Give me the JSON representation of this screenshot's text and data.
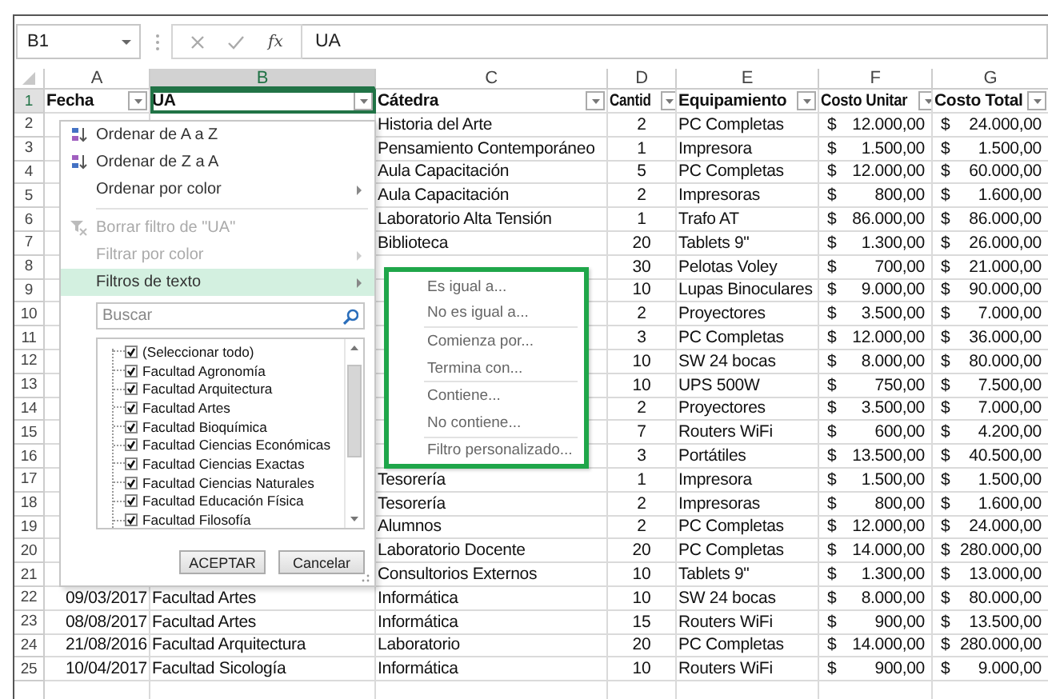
{
  "formula_bar": {
    "name_box": "B1",
    "function_label": "fx",
    "value": "UA"
  },
  "column_headers": [
    {
      "label": "A",
      "selected": false
    },
    {
      "label": "B",
      "selected": true
    },
    {
      "label": "C",
      "selected": false
    },
    {
      "label": "D",
      "selected": false
    },
    {
      "label": "E",
      "selected": false
    },
    {
      "label": "F",
      "selected": false
    },
    {
      "label": "G",
      "selected": false
    }
  ],
  "header_row": {
    "number": "1",
    "selected": true,
    "cells": [
      {
        "text": "Fecha",
        "filter": true,
        "active": false
      },
      {
        "text": "UA",
        "filter": true,
        "active": true
      },
      {
        "text": "Cátedra",
        "filter": true,
        "active": false
      },
      {
        "text": "Cantid",
        "filter": true,
        "active": false
      },
      {
        "text": "Equipamiento",
        "filter": true,
        "active": false
      },
      {
        "text": "Costo Unitar",
        "filter": true,
        "active": false
      },
      {
        "text": "Costo Total",
        "filter": true,
        "active": false
      }
    ]
  },
  "rows": [
    {
      "number": "2",
      "selected": false,
      "catedra": "Historia del Arte",
      "cantidad": "2",
      "equipamiento": "PC Completas",
      "costo_unitario": {
        "symbol": "$",
        "amount": "12.000,00"
      },
      "costo_total": {
        "symbol": "$",
        "amount": "24.000,00"
      }
    },
    {
      "number": "3",
      "selected": false,
      "catedra": "Pensamiento Contemporáneo",
      "cantidad": "1",
      "equipamiento": "Impresora",
      "costo_unitario": {
        "symbol": "$",
        "amount": "1.500,00"
      },
      "costo_total": {
        "symbol": "$",
        "amount": "1.500,00"
      }
    },
    {
      "number": "4",
      "selected": false,
      "catedra": "Aula Capacitación",
      "cantidad": "5",
      "equipamiento": "PC Completas",
      "costo_unitario": {
        "symbol": "$",
        "amount": "12.000,00"
      },
      "costo_total": {
        "symbol": "$",
        "amount": "60.000,00"
      }
    },
    {
      "number": "5",
      "selected": false,
      "catedra": "Aula Capacitación",
      "cantidad": "2",
      "equipamiento": "Impresoras",
      "costo_unitario": {
        "symbol": "$",
        "amount": "800,00"
      },
      "costo_total": {
        "symbol": "$",
        "amount": "1.600,00"
      }
    },
    {
      "number": "6",
      "selected": false,
      "catedra": "Laboratorio Alta Tensión",
      "cantidad": "1",
      "equipamiento": "Trafo AT",
      "costo_unitario": {
        "symbol": "$",
        "amount": "86.000,00"
      },
      "costo_total": {
        "symbol": "$",
        "amount": "86.000,00"
      }
    },
    {
      "number": "7",
      "selected": false,
      "catedra": "Biblioteca",
      "cantidad": "20",
      "equipamiento": "Tablets 9\"",
      "costo_unitario": {
        "symbol": "$",
        "amount": "1.300,00"
      },
      "costo_total": {
        "symbol": "$",
        "amount": "26.000,00"
      }
    },
    {
      "number": "8",
      "selected": false,
      "cantidad": "30",
      "equipamiento": "Pelotas Voley",
      "costo_unitario": {
        "symbol": "$",
        "amount": "700,00"
      },
      "costo_total": {
        "symbol": "$",
        "amount": "21.000,00"
      }
    },
    {
      "number": "9",
      "selected": false,
      "cantidad": "10",
      "equipamiento": "Lupas Binoculares",
      "costo_unitario": {
        "symbol": "$",
        "amount": "9.000,00"
      },
      "costo_total": {
        "symbol": "$",
        "amount": "90.000,00"
      }
    },
    {
      "number": "10",
      "selected": false,
      "cantidad": "2",
      "equipamiento": "Proyectores",
      "costo_unitario": {
        "symbol": "$",
        "amount": "3.500,00"
      },
      "costo_total": {
        "symbol": "$",
        "amount": "7.000,00"
      }
    },
    {
      "number": "11",
      "selected": false,
      "cantidad": "3",
      "equipamiento": "PC Completas",
      "costo_unitario": {
        "symbol": "$",
        "amount": "12.000,00"
      },
      "costo_total": {
        "symbol": "$",
        "amount": "36.000,00"
      }
    },
    {
      "number": "12",
      "selected": false,
      "cantidad": "10",
      "equipamiento": "SW 24 bocas",
      "costo_unitario": {
        "symbol": "$",
        "amount": "8.000,00"
      },
      "costo_total": {
        "symbol": "$",
        "amount": "80.000,00"
      }
    },
    {
      "number": "13",
      "selected": false,
      "cantidad": "10",
      "equipamiento": "UPS 500W",
      "costo_unitario": {
        "symbol": "$",
        "amount": "750,00"
      },
      "costo_total": {
        "symbol": "$",
        "amount": "7.500,00"
      }
    },
    {
      "number": "14",
      "selected": false,
      "cantidad": "2",
      "equipamiento": "Proyectores",
      "costo_unitario": {
        "symbol": "$",
        "amount": "3.500,00"
      },
      "costo_total": {
        "symbol": "$",
        "amount": "7.000,00"
      }
    },
    {
      "number": "15",
      "selected": false,
      "cantidad": "7",
      "equipamiento": "Routers WiFi",
      "costo_unitario": {
        "symbol": "$",
        "amount": "600,00"
      },
      "costo_total": {
        "symbol": "$",
        "amount": "4.200,00"
      }
    },
    {
      "number": "16",
      "selected": false,
      "cantidad": "3",
      "equipamiento": "Portátiles",
      "costo_unitario": {
        "symbol": "$",
        "amount": "13.500,00"
      },
      "costo_total": {
        "symbol": "$",
        "amount": "40.500,00"
      }
    },
    {
      "number": "17",
      "selected": false,
      "catedra": "Tesorería",
      "cantidad": "1",
      "equipamiento": "Impresora",
      "costo_unitario": {
        "symbol": "$",
        "amount": "1.500,00"
      },
      "costo_total": {
        "symbol": "$",
        "amount": "1.500,00"
      }
    },
    {
      "number": "18",
      "selected": false,
      "catedra": "Tesorería",
      "cantidad": "2",
      "equipamiento": "Impresoras",
      "costo_unitario": {
        "symbol": "$",
        "amount": "800,00"
      },
      "costo_total": {
        "symbol": "$",
        "amount": "1.600,00"
      }
    },
    {
      "number": "19",
      "selected": false,
      "catedra": "Alumnos",
      "cantidad": "2",
      "equipamiento": "PC Completas",
      "costo_unitario": {
        "symbol": "$",
        "amount": "12.000,00"
      },
      "costo_total": {
        "symbol": "$",
        "amount": "24.000,00"
      }
    },
    {
      "number": "20",
      "selected": false,
      "catedra": "Laboratorio Docente",
      "cantidad": "20",
      "equipamiento": "PC Completas",
      "costo_unitario": {
        "symbol": "$",
        "amount": "14.000,00"
      },
      "costo_total": {
        "symbol": "$",
        "amount": "280.000,00"
      }
    },
    {
      "number": "21",
      "selected": false,
      "catedra": "Consultorios Externos",
      "cantidad": "10",
      "equipamiento": "Tablets 9\"",
      "costo_unitario": {
        "symbol": "$",
        "amount": "1.300,00"
      },
      "costo_total": {
        "symbol": "$",
        "amount": "13.000,00"
      }
    },
    {
      "number": "22",
      "selected": false,
      "fecha": "09/03/2017",
      "ua": "Facultad Artes",
      "catedra": "Informática",
      "cantidad": "10",
      "equipamiento": "SW 24 bocas",
      "costo_unitario": {
        "symbol": "$",
        "amount": "8.000,00"
      },
      "costo_total": {
        "symbol": "$",
        "amount": "80.000,00"
      }
    },
    {
      "number": "23",
      "selected": false,
      "fecha": "08/08/2017",
      "ua": "Facultad Artes",
      "catedra": "Informática",
      "cantidad": "15",
      "equipamiento": "Routers WiFi",
      "costo_unitario": {
        "symbol": "$",
        "amount": "900,00"
      },
      "costo_total": {
        "symbol": "$",
        "amount": "13.500,00"
      }
    },
    {
      "number": "24",
      "selected": false,
      "fecha": "21/08/2016",
      "ua": "Facultad Arquitectura",
      "catedra": "Laboratorio",
      "cantidad": "20",
      "equipamiento": "PC Completas",
      "costo_unitario": {
        "symbol": "$",
        "amount": "14.000,00"
      },
      "costo_total": {
        "symbol": "$",
        "amount": "280.000,00"
      }
    },
    {
      "number": "25",
      "selected": false,
      "fecha": "10/04/2017",
      "ua": "Facultad Sicología",
      "catedra": "Informática",
      "cantidad": "10",
      "equipamiento": "Routers WiFi",
      "costo_unitario": {
        "symbol": "$",
        "amount": "900,00"
      },
      "costo_total": {
        "symbol": "$",
        "amount": "9.000,00"
      }
    }
  ],
  "filter_menu": {
    "items": [
      {
        "kind": "sort_ascending",
        "label": "Ordenar de A a Z",
        "disabled": false,
        "selected": false,
        "submenu": false
      },
      {
        "kind": "sort_descending",
        "label": "Ordenar de Z a A",
        "disabled": false,
        "selected": false,
        "submenu": false
      },
      {
        "kind": "item",
        "label": "Ordenar por color",
        "disabled": false,
        "selected": false,
        "submenu": true
      },
      {
        "kind": "separator"
      },
      {
        "kind": "clear_filter",
        "label": "Borrar filtro de \"UA\"",
        "disabled": true,
        "selected": false,
        "submenu": false
      },
      {
        "kind": "item",
        "label": "Filtrar por color",
        "disabled": true,
        "selected": false,
        "submenu": true
      },
      {
        "kind": "item",
        "label": "Filtros de texto",
        "disabled": false,
        "selected": true,
        "submenu": true
      }
    ],
    "search": {
      "placeholder": "Buscar"
    },
    "values": [
      {
        "label": "(Seleccionar todo)",
        "checked": true
      },
      {
        "label": "Facultad Agronomía",
        "checked": true
      },
      {
        "label": "Facultad Arquitectura",
        "checked": true
      },
      {
        "label": "Facultad Artes",
        "checked": true
      },
      {
        "label": "Facultad Bioquímica",
        "checked": true
      },
      {
        "label": "Facultad Ciencias Económicas",
        "checked": true
      },
      {
        "label": "Facultad Ciencias Exactas",
        "checked": true
      },
      {
        "label": "Facultad Ciencias Naturales",
        "checked": true
      },
      {
        "label": "Facultad Educación Física",
        "checked": true
      },
      {
        "label": "Facultad Filosofía",
        "checked": true
      }
    ],
    "buttons": [
      {
        "label": "ACEPTAR"
      },
      {
        "label": "Cancelar"
      }
    ]
  },
  "text_filter_menu": {
    "items": [
      {
        "kind": "item",
        "label": "Es igual a..."
      },
      {
        "kind": "item",
        "label": "No es igual a..."
      },
      {
        "kind": "separator"
      },
      {
        "kind": "item",
        "label": "Comienza por..."
      },
      {
        "kind": "item",
        "label": "Termina con..."
      },
      {
        "kind": "separator"
      },
      {
        "kind": "item",
        "label": "Contiene..."
      },
      {
        "kind": "item",
        "label": "No contiene..."
      },
      {
        "kind": "separator"
      },
      {
        "kind": "item",
        "label": "Filtro personalizado..."
      }
    ]
  }
}
